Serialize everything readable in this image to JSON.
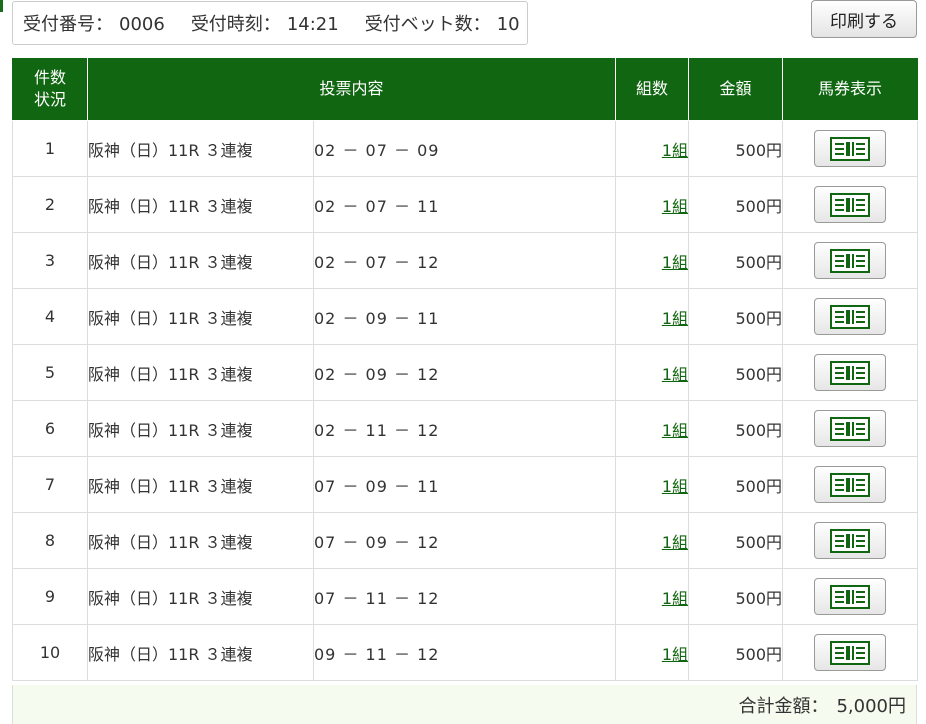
{
  "header": {
    "receipt_number_label": "受付番号：",
    "receipt_number": "0006",
    "receipt_time_label": "受付時刻：",
    "receipt_time": "14:21",
    "bet_count_label": "受付ベット数：",
    "bet_count": "10",
    "print_label": "印刷する"
  },
  "table": {
    "columns": {
      "no_line1": "件数",
      "no_line2": "状況",
      "content": "投票内容",
      "kumi": "組数",
      "amount": "金額",
      "ticket": "馬券表示"
    },
    "rows": [
      {
        "no": "1",
        "race": "阪神（日）11R ３連複",
        "combo": "02 － 07 － 09",
        "kumi": "1組",
        "amount": "500円"
      },
      {
        "no": "2",
        "race": "阪神（日）11R ３連複",
        "combo": "02 － 07 － 11",
        "kumi": "1組",
        "amount": "500円"
      },
      {
        "no": "3",
        "race": "阪神（日）11R ３連複",
        "combo": "02 － 07 － 12",
        "kumi": "1組",
        "amount": "500円"
      },
      {
        "no": "4",
        "race": "阪神（日）11R ３連複",
        "combo": "02 － 09 － 11",
        "kumi": "1組",
        "amount": "500円"
      },
      {
        "no": "5",
        "race": "阪神（日）11R ３連複",
        "combo": "02 － 09 － 12",
        "kumi": "1組",
        "amount": "500円"
      },
      {
        "no": "6",
        "race": "阪神（日）11R ３連複",
        "combo": "02 － 11 － 12",
        "kumi": "1組",
        "amount": "500円"
      },
      {
        "no": "7",
        "race": "阪神（日）11R ３連複",
        "combo": "07 － 09 － 11",
        "kumi": "1組",
        "amount": "500円"
      },
      {
        "no": "8",
        "race": "阪神（日）11R ３連複",
        "combo": "07 － 09 － 12",
        "kumi": "1組",
        "amount": "500円"
      },
      {
        "no": "9",
        "race": "阪神（日）11R ３連複",
        "combo": "07 － 11 － 12",
        "kumi": "1組",
        "amount": "500円"
      },
      {
        "no": "10",
        "race": "阪神（日）11R ３連複",
        "combo": "09 － 11 － 12",
        "kumi": "1組",
        "amount": "500円"
      }
    ],
    "ticket_icon": "ticket-icon"
  },
  "total": {
    "label": "合計金額：",
    "value": "5,000円"
  },
  "colors": {
    "header_green": "#116611",
    "link_green": "#116611",
    "total_bg": "#f5fbee"
  }
}
